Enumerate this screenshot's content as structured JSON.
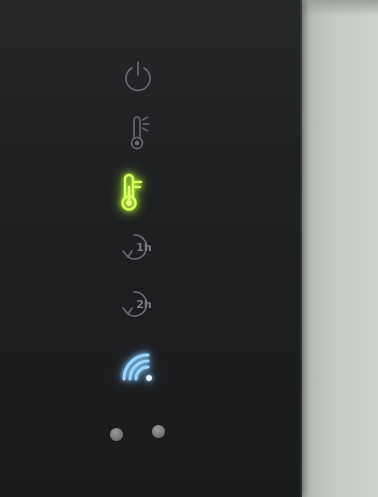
{
  "device": {
    "panel_color": "#1f2022",
    "wall_color": "#c6ccc6",
    "indicators": [
      {
        "name": "power-icon",
        "state": "off"
      },
      {
        "name": "thermometer-comfort-icon",
        "state": "off"
      },
      {
        "name": "thermometer-eco-icon",
        "state": "on",
        "color": "#c8ff3c"
      },
      {
        "name": "timer-1h-icon",
        "label": "1h",
        "state": "off"
      },
      {
        "name": "timer-2h-icon",
        "label": "2h",
        "state": "off"
      },
      {
        "name": "wifi-icon",
        "state": "on",
        "color": "#8fcfff"
      }
    ],
    "buttons": [
      "left-touch-dot",
      "right-touch-dot"
    ]
  }
}
